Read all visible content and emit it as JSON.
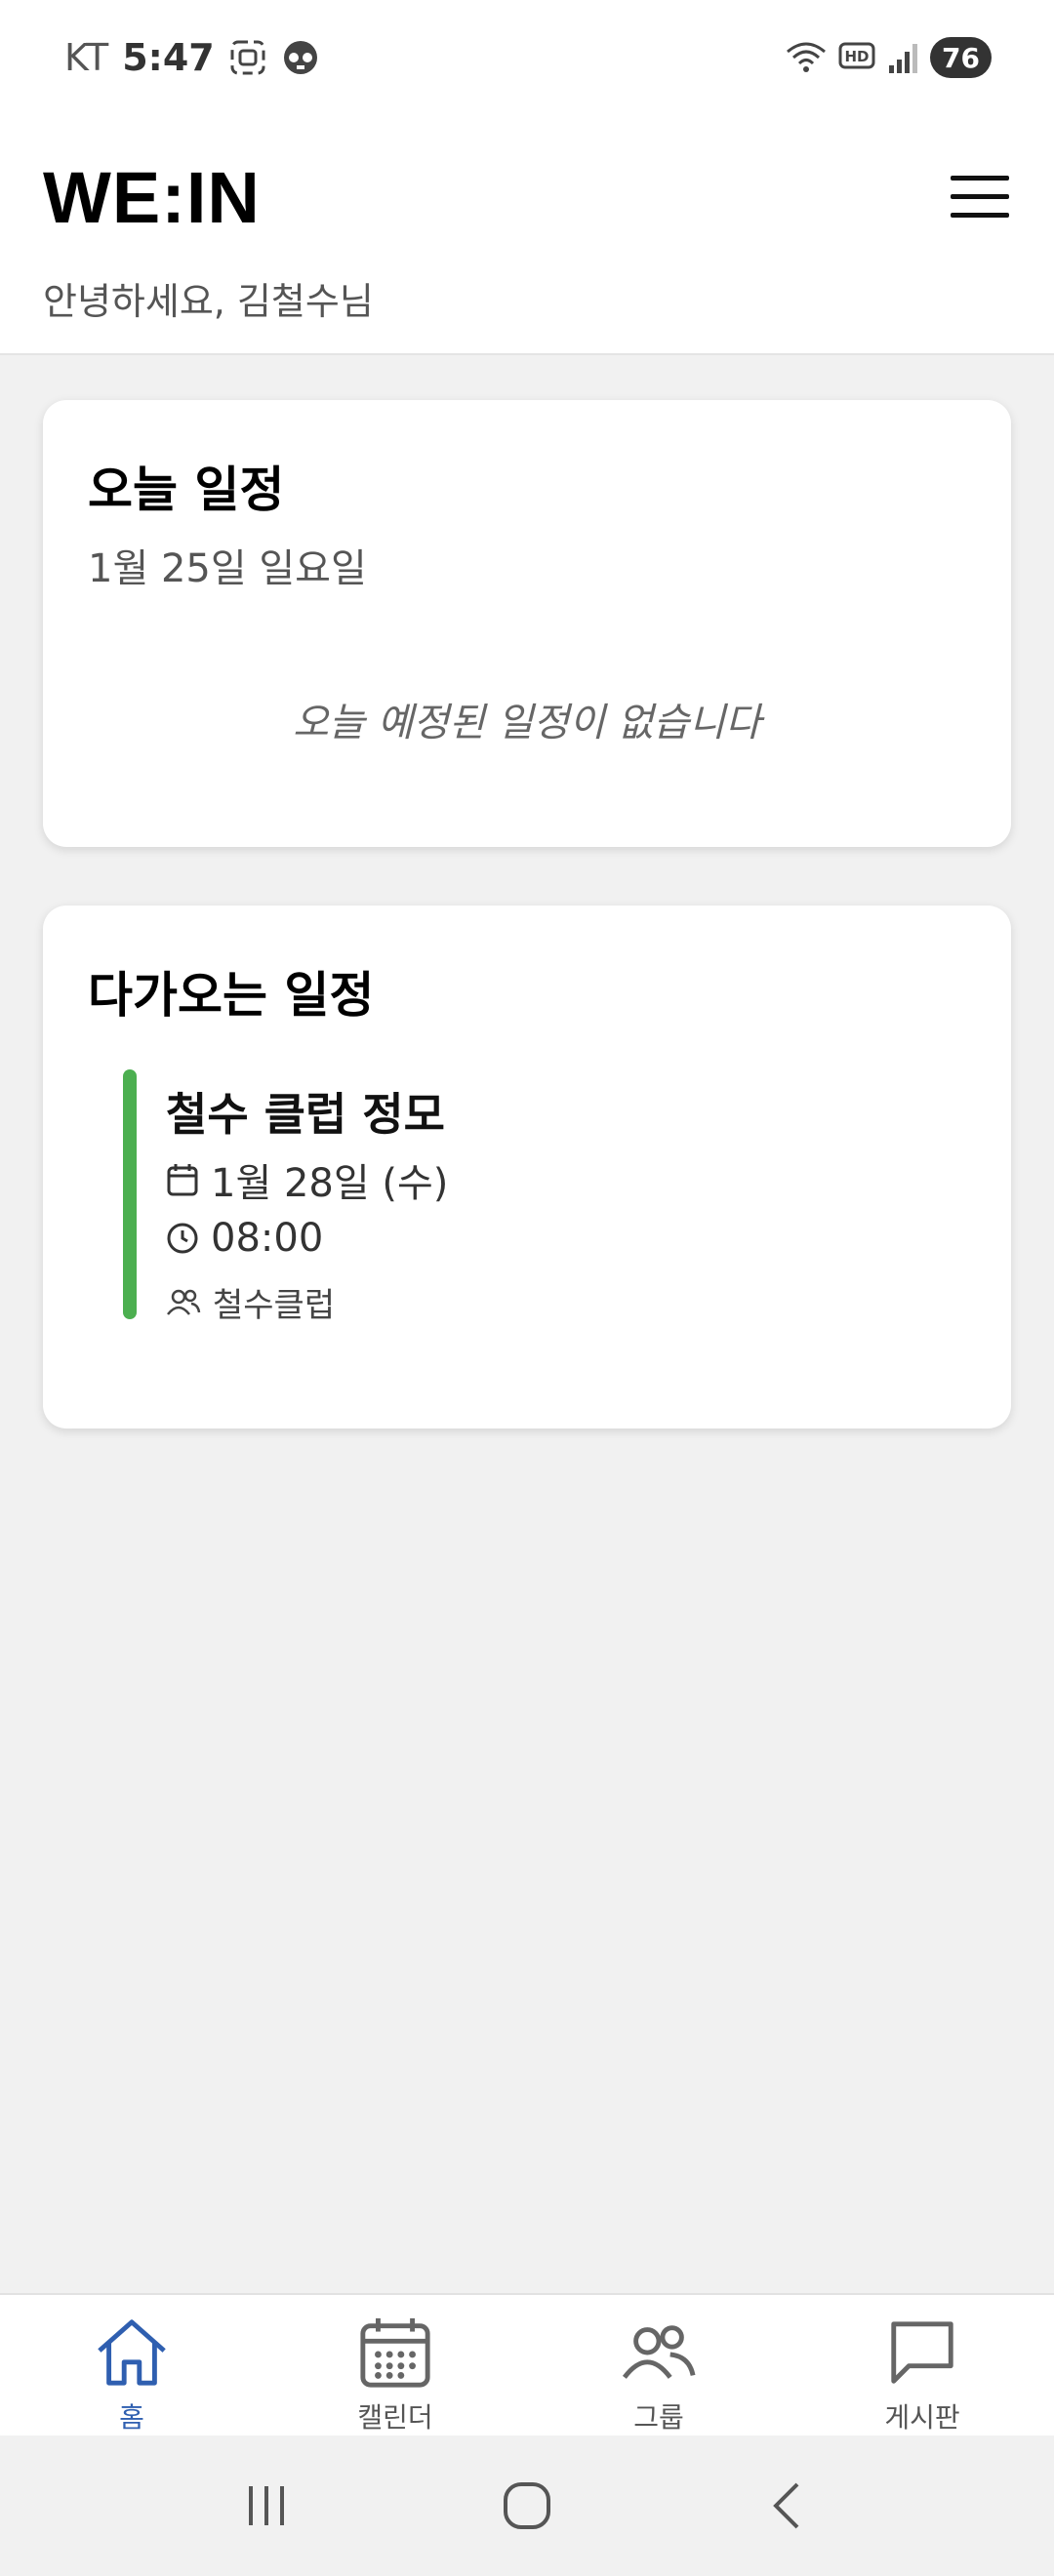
{
  "status_bar": {
    "carrier": "KT",
    "time": "5:47",
    "battery": "76"
  },
  "header": {
    "brand": "WE:IN",
    "greeting": "안녕하세요, 김철수님"
  },
  "today": {
    "title": "오늘 일정",
    "date": "1월 25일 일요일",
    "empty_message": "오늘 예정된 일정이 없습니다"
  },
  "upcoming": {
    "title": "다가오는 일정",
    "events": [
      {
        "title": "철수 클럽 정모",
        "date": "1월 28일 (수)",
        "time": "08:00",
        "group": "철수클럽",
        "color": "#4caf50"
      }
    ]
  },
  "bottom_nav": {
    "items": [
      {
        "label": "홈",
        "icon": "home-icon",
        "active": true
      },
      {
        "label": "캘린더",
        "icon": "calendar-icon",
        "active": false
      },
      {
        "label": "그룹",
        "icon": "users-icon",
        "active": false
      },
      {
        "label": "게시판",
        "icon": "message-icon",
        "active": false
      }
    ]
  },
  "colors": {
    "accent": "#2f5fb0",
    "event": "#4caf50"
  }
}
